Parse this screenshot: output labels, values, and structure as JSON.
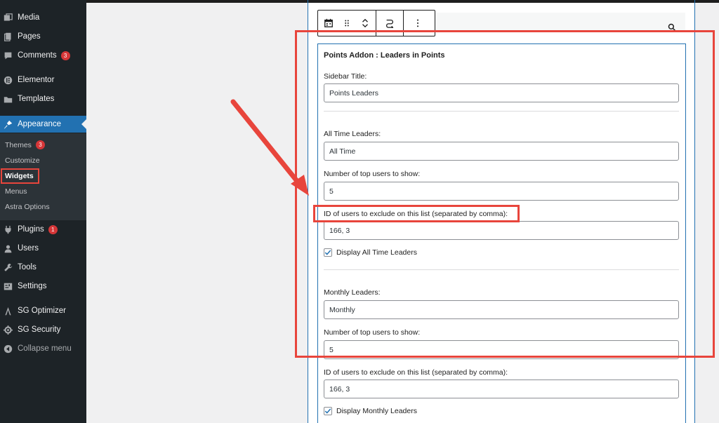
{
  "sidebar": {
    "items": [
      {
        "label": "Media",
        "icon": "media-icon"
      },
      {
        "label": "Pages",
        "icon": "pages-icon"
      },
      {
        "label": "Comments",
        "icon": "comments-icon",
        "badge": "3"
      },
      {
        "label": "Elementor",
        "icon": "elementor-icon"
      },
      {
        "label": "Templates",
        "icon": "templates-icon"
      },
      {
        "label": "Appearance",
        "icon": "appearance-icon"
      },
      {
        "label": "Plugins",
        "icon": "plugins-icon",
        "badge": "1"
      },
      {
        "label": "Users",
        "icon": "users-icon"
      },
      {
        "label": "Tools",
        "icon": "tools-icon"
      },
      {
        "label": "Settings",
        "icon": "settings-icon"
      },
      {
        "label": "SG Optimizer",
        "icon": "sg-optimizer-icon"
      },
      {
        "label": "SG Security",
        "icon": "sg-security-icon"
      },
      {
        "label": "Collapse menu",
        "icon": "collapse-icon"
      }
    ],
    "submenu": [
      {
        "label": "Themes",
        "badge": "3"
      },
      {
        "label": "Customize"
      },
      {
        "label": "Widgets"
      },
      {
        "label": "Menus"
      },
      {
        "label": "Astra Options"
      }
    ]
  },
  "toolbar": {
    "icons": [
      "calendar-icon",
      "drag-handle-icon",
      "move-up-down-icon",
      "transform-icon",
      "more-options-icon"
    ]
  },
  "widget": {
    "title": "Points Addon : Leaders in Points",
    "sidebar_title_label": "Sidebar Title:",
    "sidebar_title_value": "Points Leaders",
    "all_time_label": "All Time Leaders:",
    "all_time_value": "All Time",
    "all_time_count_label": "Number of top users to show:",
    "all_time_count_value": "5",
    "all_time_exclude_label": "ID of users to exclude on this list (separated by comma):",
    "all_time_exclude_value": "166, 3",
    "all_time_display_label": "Display All Time Leaders",
    "monthly_label": "Monthly Leaders:",
    "monthly_value": "Monthly",
    "monthly_count_label": "Number of top users to show:",
    "monthly_count_value": "5",
    "monthly_exclude_label": "ID of users to exclude on this list (separated by comma):",
    "monthly_exclude_value": "166, 3",
    "monthly_display_label": "Display Monthly Leaders"
  },
  "colors": {
    "sidebar_bg": "#1d2327",
    "active": "#2271b1",
    "annotation": "#e8453c",
    "badge": "#d63638"
  }
}
